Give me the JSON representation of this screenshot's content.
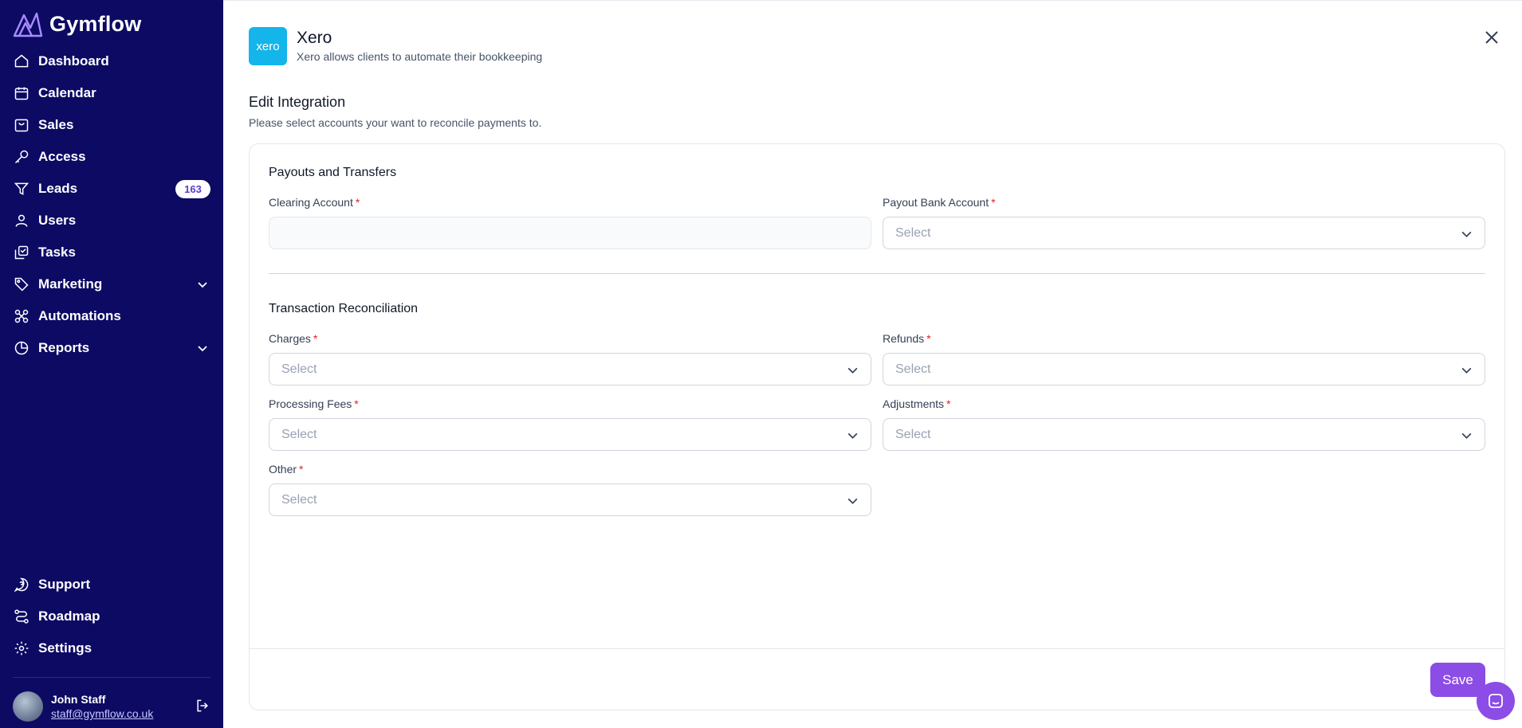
{
  "app": {
    "name": "Gymflow"
  },
  "nav": {
    "items": [
      {
        "label": "Dashboard",
        "icon": "home-icon"
      },
      {
        "label": "Calendar",
        "icon": "calendar-icon"
      },
      {
        "label": "Sales",
        "icon": "sales-icon"
      },
      {
        "label": "Access",
        "icon": "key-icon"
      },
      {
        "label": "Leads",
        "icon": "filter-icon",
        "badge": "163"
      },
      {
        "label": "Users",
        "icon": "users-icon"
      },
      {
        "label": "Tasks",
        "icon": "tasks-icon"
      },
      {
        "label": "Marketing",
        "icon": "tag-icon",
        "expandable": true
      },
      {
        "label": "Automations",
        "icon": "automations-icon"
      },
      {
        "label": "Reports",
        "icon": "pie-chart-icon",
        "expandable": true
      }
    ],
    "bottom": [
      {
        "label": "Support",
        "icon": "support-icon"
      },
      {
        "label": "Roadmap",
        "icon": "roadmap-icon"
      },
      {
        "label": "Settings",
        "icon": "gear-icon"
      }
    ]
  },
  "user": {
    "name": "John Staff",
    "email": "staff@gymflow.co.uk"
  },
  "integration": {
    "logo_text": "xero",
    "name": "Xero",
    "description": "Xero allows clients to automate their bookkeeping",
    "brand_color": "#13b5ea"
  },
  "edit": {
    "title": "Edit Integration",
    "subtitle": "Please select accounts your want to reconcile payments to."
  },
  "payouts": {
    "title": "Payouts and Transfers",
    "clearing_label": "Clearing Account",
    "clearing_value": "",
    "bank_label": "Payout Bank Account",
    "bank_placeholder": "Select"
  },
  "reconciliation": {
    "title": "Transaction Reconciliation",
    "charges_label": "Charges",
    "charges_placeholder": "Select",
    "refunds_label": "Refunds",
    "refunds_placeholder": "Select",
    "fees_label": "Processing Fees",
    "fees_placeholder": "Select",
    "adjustments_label": "Adjustments",
    "adjustments_placeholder": "Select",
    "other_label": "Other",
    "other_placeholder": "Select"
  },
  "required_mark": "*",
  "footer": {
    "save_label": "Save"
  },
  "colors": {
    "sidebar": "#0d0a64",
    "accent": "#8c4ce6",
    "required": "#e0232b"
  }
}
